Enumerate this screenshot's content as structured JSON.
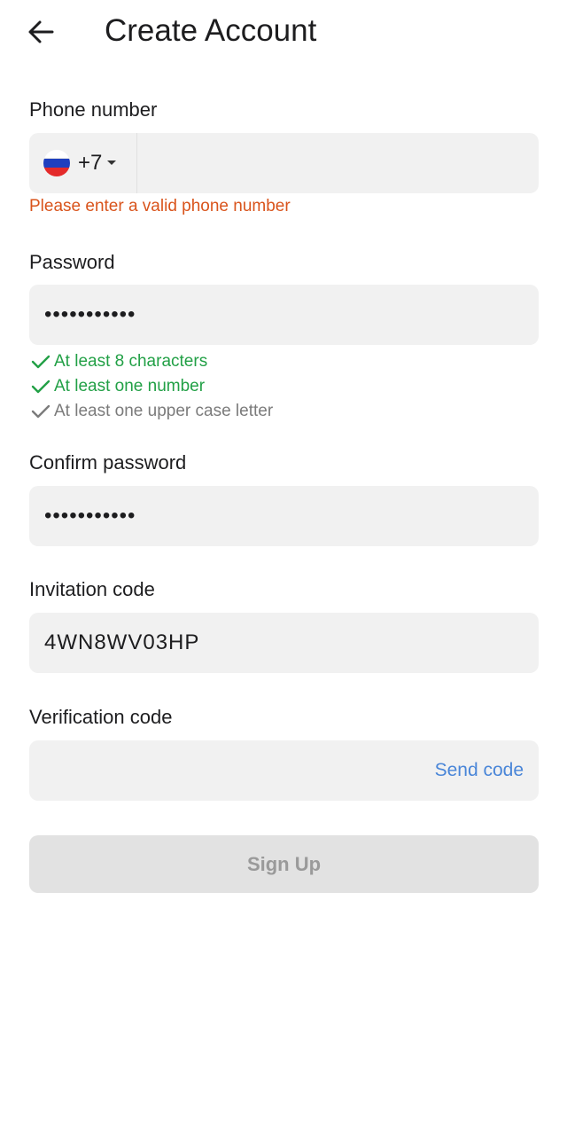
{
  "header": {
    "title": "Create Account",
    "back_icon": "arrow-left-icon"
  },
  "phone": {
    "label": "Phone number",
    "country_flag": "russia-flag-icon",
    "dial_code": "+7",
    "value": "",
    "error": "Please enter a valid phone number"
  },
  "password": {
    "label": "Password",
    "value": "•••••••••••",
    "rules": [
      {
        "text": "At least 8 characters",
        "status": "met"
      },
      {
        "text": "At least one number",
        "status": "met"
      },
      {
        "text": "At least one upper case letter",
        "status": "unmet"
      }
    ]
  },
  "confirm_password": {
    "label": "Confirm password",
    "value": "•••••••••••"
  },
  "invitation": {
    "label": "Invitation code",
    "value": "4WN8WV03HP"
  },
  "verification": {
    "label": "Verification code",
    "value": "",
    "send_label": "Send code"
  },
  "signup": {
    "label": "Sign Up",
    "enabled": false
  },
  "colors": {
    "error": "#d9541c",
    "rule_met": "#22a046",
    "rule_unmet": "#7b7b7b",
    "link": "#4a86d8",
    "field_bg": "#f1f1f1",
    "button_disabled_bg": "#e2e2e2"
  }
}
